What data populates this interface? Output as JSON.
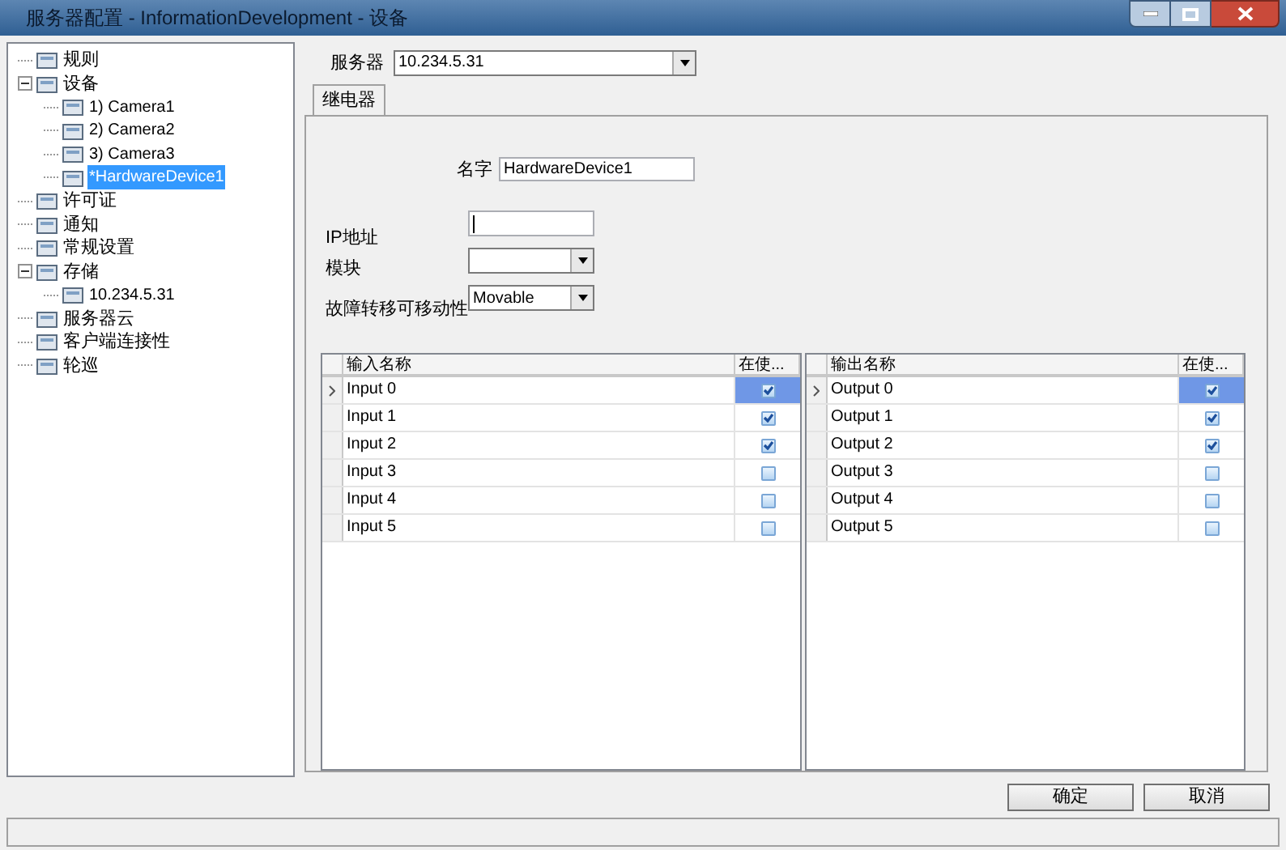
{
  "window": {
    "title": "服务器配置 - InformationDevelopment - 设备"
  },
  "tree": [
    {
      "label": "规则",
      "selected": false
    },
    {
      "label": "设备",
      "selected": false,
      "expanded": true,
      "children": [
        {
          "label": "1) Camera1",
          "selected": false
        },
        {
          "label": "2) Camera2",
          "selected": false
        },
        {
          "label": "3) Camera3",
          "selected": false
        },
        {
          "label": "*HardwareDevice1",
          "selected": true
        }
      ]
    },
    {
      "label": "许可证",
      "selected": false
    },
    {
      "label": "通知",
      "selected": false
    },
    {
      "label": "常规设置",
      "selected": false
    },
    {
      "label": "存储",
      "selected": false,
      "expanded": true,
      "children": [
        {
          "label": "10.234.5.31",
          "selected": false
        }
      ]
    },
    {
      "label": "服务器云",
      "selected": false
    },
    {
      "label": "客户端连接性",
      "selected": false
    },
    {
      "label": "轮巡",
      "selected": false
    }
  ],
  "server": {
    "label": "服务器",
    "value": "10.234.5.31"
  },
  "tabs": [
    {
      "label": "继电器",
      "selected": true
    }
  ],
  "form": {
    "name_label": "名字",
    "name_value": "HardwareDevice1",
    "ip_label": "IP地址",
    "module_label": "模块",
    "failover_label": "故障转移可移动性",
    "failover_value": "Movable"
  },
  "grids": [
    {
      "columns": [
        "输入名称",
        "在使..."
      ],
      "rows": [
        {
          "name": "Input 0",
          "in_use": true,
          "selected": true
        },
        {
          "name": "Input 1",
          "in_use": true,
          "selected": false
        },
        {
          "name": "Input 2",
          "in_use": true,
          "selected": false
        },
        {
          "name": "Input 3",
          "in_use": false,
          "selected": false
        },
        {
          "name": "Input 4",
          "in_use": false,
          "selected": false
        },
        {
          "name": "Input 5",
          "in_use": false,
          "selected": false
        }
      ]
    },
    {
      "columns": [
        "输出名称",
        "在使..."
      ],
      "rows": [
        {
          "name": "Output 0",
          "in_use": true,
          "selected": true
        },
        {
          "name": "Output 1",
          "in_use": true,
          "selected": false
        },
        {
          "name": "Output 2",
          "in_use": true,
          "selected": false
        },
        {
          "name": "Output 3",
          "in_use": false,
          "selected": false
        },
        {
          "name": "Output 4",
          "in_use": false,
          "selected": false
        },
        {
          "name": "Output 5",
          "in_use": false,
          "selected": false
        }
      ]
    }
  ],
  "buttons": [
    "确定",
    "取消"
  ]
}
